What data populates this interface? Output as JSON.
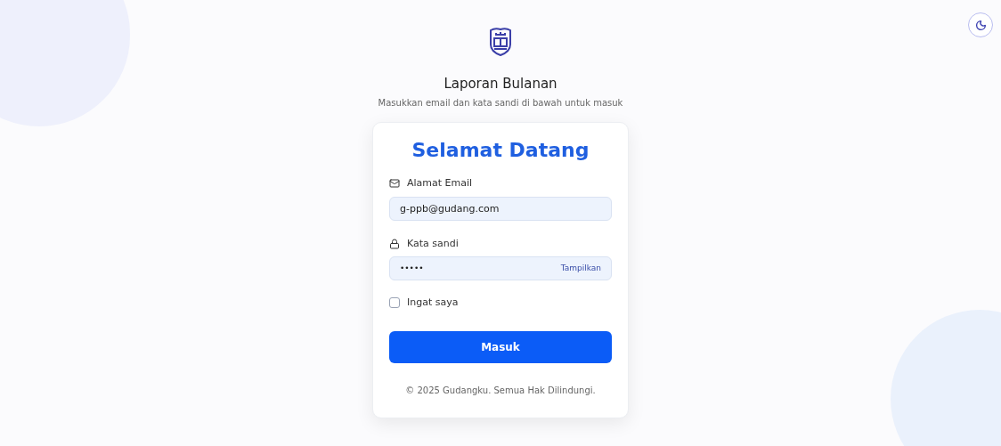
{
  "app": {
    "title": "Laporan Bulanan",
    "subtitle": "Masukkan email dan kata sandi di bawah untuk masuk"
  },
  "card": {
    "heading": "Selamat Datang",
    "email": {
      "label": "Alamat Email",
      "value": "g-ppb@gudang.com"
    },
    "password": {
      "label": "Kata sandi",
      "value": "•••••",
      "toggle": "Tampilkan"
    },
    "remember": {
      "label": "Ingat saya",
      "checked": false
    },
    "submit": "Masuk",
    "footer": "© 2025 Gudangku. Semua Hak Dilindungi."
  }
}
